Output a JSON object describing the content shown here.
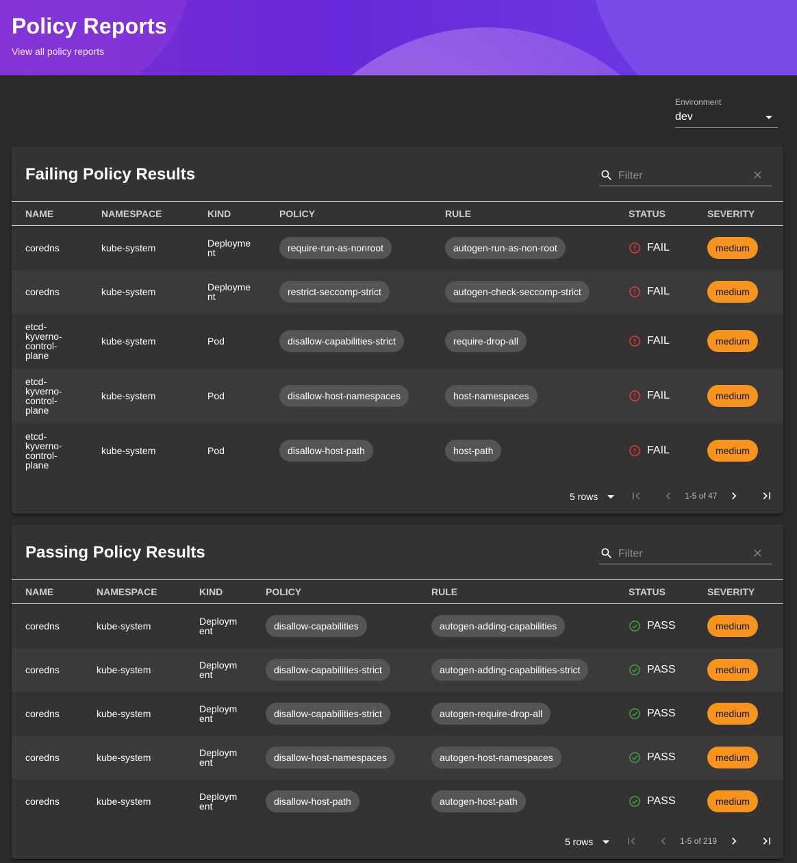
{
  "header": {
    "title": "Policy Reports",
    "subtitle": "View all policy reports"
  },
  "environment": {
    "label": "Environment",
    "value": "dev"
  },
  "columns": [
    "NAME",
    "NAMESPACE",
    "KIND",
    "POLICY",
    "RULE",
    "STATUS",
    "SEVERITY"
  ],
  "failing": {
    "title": "Failing Policy Results",
    "filter_placeholder": "Filter",
    "rows": [
      {
        "name": [
          "coredns"
        ],
        "namespace": "kube-system",
        "kind": [
          "Deployme",
          "nt"
        ],
        "policy": "require-run-as-nonroot",
        "rule": "autogen-run-as-non-root",
        "status": "FAIL",
        "severity": "medium"
      },
      {
        "name": [
          "coredns"
        ],
        "namespace": "kube-system",
        "kind": [
          "Deployme",
          "nt"
        ],
        "policy": "restrict-seccomp-strict",
        "rule": "autogen-check-seccomp-strict",
        "status": "FAIL",
        "severity": "medium"
      },
      {
        "name": [
          "etcd-",
          "kyverno-",
          "control-",
          "plane"
        ],
        "namespace": "kube-system",
        "kind": [
          "Pod"
        ],
        "policy": "disallow-capabilities-strict",
        "rule": "require-drop-all",
        "status": "FAIL",
        "severity": "medium"
      },
      {
        "name": [
          "etcd-",
          "kyverno-",
          "control-",
          "plane"
        ],
        "namespace": "kube-system",
        "kind": [
          "Pod"
        ],
        "policy": "disallow-host-namespaces",
        "rule": "host-namespaces",
        "status": "FAIL",
        "severity": "medium"
      },
      {
        "name": [
          "etcd-",
          "kyverno-",
          "control-",
          "plane"
        ],
        "namespace": "kube-system",
        "kind": [
          "Pod"
        ],
        "policy": "disallow-host-path",
        "rule": "host-path",
        "status": "FAIL",
        "severity": "medium"
      }
    ],
    "pager": {
      "rows_label": "5 rows",
      "range": "1-5 of 47"
    }
  },
  "passing": {
    "title": "Passing Policy Results",
    "filter_placeholder": "Filter",
    "rows": [
      {
        "name": [
          "coredns"
        ],
        "namespace": "kube-system",
        "kind": [
          "Deploym",
          "ent"
        ],
        "policy": "disallow-capabilities",
        "rule": "autogen-adding-capabilities",
        "status": "PASS",
        "severity": "medium"
      },
      {
        "name": [
          "coredns"
        ],
        "namespace": "kube-system",
        "kind": [
          "Deploym",
          "ent"
        ],
        "policy": "disallow-capabilities-strict",
        "rule": "autogen-adding-capabilities-strict",
        "status": "PASS",
        "severity": "medium"
      },
      {
        "name": [
          "coredns"
        ],
        "namespace": "kube-system",
        "kind": [
          "Deploym",
          "ent"
        ],
        "policy": "disallow-capabilities-strict",
        "rule": "autogen-require-drop-all",
        "status": "PASS",
        "severity": "medium"
      },
      {
        "name": [
          "coredns"
        ],
        "namespace": "kube-system",
        "kind": [
          "Deploym",
          "ent"
        ],
        "policy": "disallow-host-namespaces",
        "rule": "autogen-host-namespaces",
        "status": "PASS",
        "severity": "medium"
      },
      {
        "name": [
          "coredns"
        ],
        "namespace": "kube-system",
        "kind": [
          "Deploym",
          "ent"
        ],
        "policy": "disallow-host-path",
        "rule": "autogen-host-path",
        "status": "PASS",
        "severity": "medium"
      }
    ],
    "pager": {
      "rows_label": "5 rows",
      "range": "1-5 of 219"
    }
  },
  "colors": {
    "fail": "#e53935",
    "pass": "#43a047",
    "severity_medium": "#f7941d",
    "header_purple": "#6a28d9"
  }
}
